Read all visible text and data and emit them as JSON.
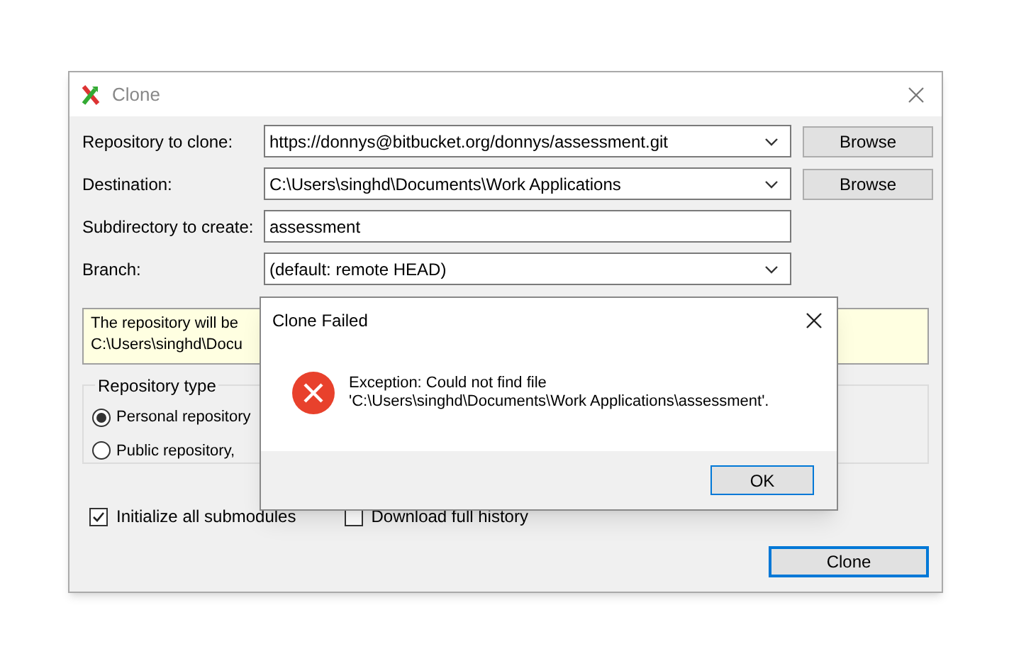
{
  "window": {
    "title": "Clone"
  },
  "fields": [
    {
      "label": "Repository to clone:",
      "value": "https://donnys@bitbucket.org/donnys/assessment.git",
      "kind": "combo",
      "browse": "Browse"
    },
    {
      "label": "Destination:",
      "value": "C:\\Users\\singhd\\Documents\\Work Applications",
      "kind": "combo",
      "browse": "Browse"
    },
    {
      "label": "Subdirectory to create:",
      "value": "assessment",
      "kind": "text"
    },
    {
      "label": "Branch:",
      "value": "(default: remote HEAD)",
      "kind": "combo"
    }
  ],
  "info_lines": [
    "The repository will be",
    "C:\\Users\\singhd\\Docu"
  ],
  "repository_type": {
    "title": "Repository type",
    "options": [
      {
        "label": "Personal repository",
        "selected": true
      },
      {
        "label": "Public repository,",
        "selected": false
      }
    ]
  },
  "checkboxes": [
    {
      "label": "Initialize all submodules",
      "checked": true
    },
    {
      "label": "Download full history",
      "checked": false
    }
  ],
  "clone_button": "Clone",
  "dialog": {
    "title": "Clone Failed",
    "message_lines": [
      "Exception: Could not find file",
      "'C:\\Users\\singhd\\Documents\\Work Applications\\assessment'."
    ],
    "ok": "OK"
  }
}
